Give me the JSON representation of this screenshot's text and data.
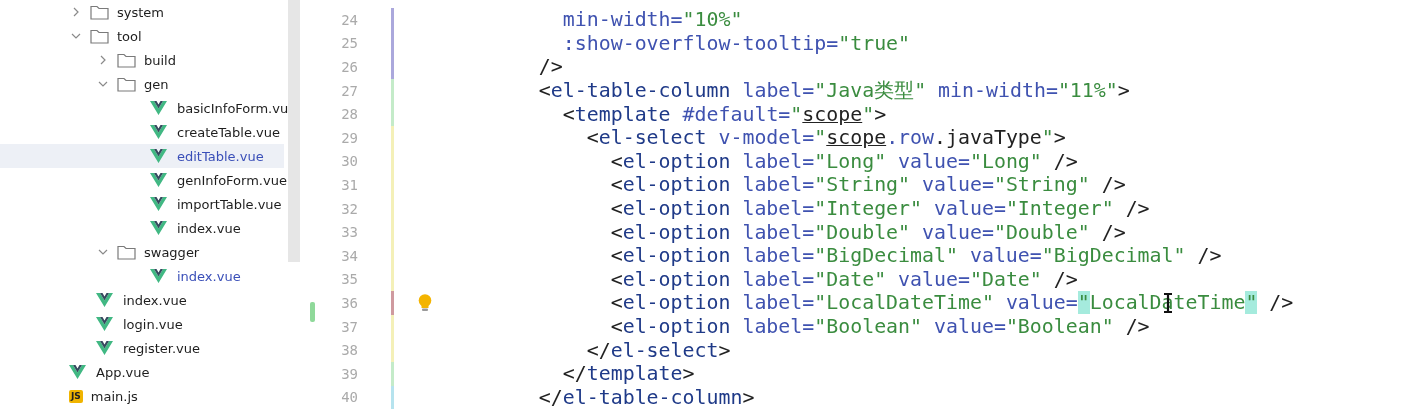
{
  "project_tree": {
    "items": [
      {
        "children": [
          {
            "label": "system",
            "kind": "folder",
            "expanded": false,
            "selected": false,
            "modified": false
          },
          {
            "label": "tool",
            "kind": "folder",
            "expanded": true,
            "selected": false,
            "modified": false,
            "children": [
              {
                "label": "build",
                "kind": "folder",
                "expanded": false,
                "selected": false,
                "modified": false
              },
              {
                "label": "gen",
                "kind": "folder",
                "expanded": true,
                "selected": false,
                "modified": false,
                "children": [
                  {
                    "label": "basicInfoForm.vu",
                    "kind": "vue",
                    "selected": false,
                    "modified": false
                  },
                  {
                    "label": "createTable.vue",
                    "kind": "vue",
                    "selected": false,
                    "modified": false
                  },
                  {
                    "label": "editTable.vue",
                    "kind": "vue",
                    "selected": true,
                    "modified": true
                  },
                  {
                    "label": "genInfoForm.vue",
                    "kind": "vue",
                    "selected": false,
                    "modified": false
                  },
                  {
                    "label": "importTable.vue",
                    "kind": "vue",
                    "selected": false,
                    "modified": false
                  },
                  {
                    "label": "index.vue",
                    "kind": "vue",
                    "selected": false,
                    "modified": false
                  }
                ]
              },
              {
                "label": "swagger",
                "kind": "folder",
                "expanded": true,
                "selected": false,
                "modified": false,
                "children": [
                  {
                    "label": "index.vue",
                    "kind": "vue",
                    "selected": false,
                    "modified": true
                  }
                ]
              }
            ]
          },
          {
            "label": "index.vue",
            "kind": "vue",
            "selected": false,
            "modified": false
          },
          {
            "label": "login.vue",
            "kind": "vue",
            "selected": false,
            "modified": false
          },
          {
            "label": "register.vue",
            "kind": "vue",
            "selected": false,
            "modified": false
          }
        ]
      },
      {
        "label": "App.vue",
        "kind": "vue",
        "selected": false,
        "modified": false
      },
      {
        "label": "main.js",
        "kind": "js",
        "icon_text": "JS",
        "selected": false,
        "modified": false
      }
    ]
  },
  "editor": {
    "lines": [
      {
        "number": "24",
        "color": "#aba8dc",
        "bulb": false,
        "pointer": false,
        "tokens": [
          {
            "kind": "attr",
            "text": "         min-width="
          },
          {
            "kind": "str",
            "text": "\"10%\""
          }
        ]
      },
      {
        "number": "25",
        "color": "#aba8dc",
        "bulb": false,
        "pointer": false,
        "tokens": [
          {
            "kind": "attr",
            "text": "         :show-overflow-tooltip="
          },
          {
            "kind": "str",
            "text": "\"true\""
          }
        ]
      },
      {
        "number": "26",
        "color": "#aba8dc",
        "bulb": false,
        "pointer": false,
        "tokens": [
          {
            "kind": "p",
            "text": "       />"
          }
        ]
      },
      {
        "number": "27",
        "color": "#c4ebc9",
        "bulb": false,
        "pointer": false,
        "tokens": [
          {
            "kind": "p",
            "text": "       <"
          },
          {
            "kind": "tag",
            "text": "el-table-column"
          },
          {
            "kind": "attr",
            "text": " label="
          },
          {
            "kind": "str",
            "text": "\"Java类型\""
          },
          {
            "kind": "attr",
            "text": " min-width="
          },
          {
            "kind": "str",
            "text": "\"11%\""
          },
          {
            "kind": "p",
            "text": ">"
          }
        ]
      },
      {
        "number": "28",
        "color": "#c4ebc9",
        "bulb": false,
        "pointer": false,
        "tokens": [
          {
            "kind": "p",
            "text": "         <"
          },
          {
            "kind": "tag",
            "text": "template"
          },
          {
            "kind": "attr",
            "text": " #default="
          },
          {
            "kind": "str",
            "text": "\""
          },
          {
            "kind": "ref",
            "text": "scope"
          },
          {
            "kind": "str",
            "text": "\""
          },
          {
            "kind": "p",
            "text": ">"
          }
        ]
      },
      {
        "number": "29",
        "color": "#f4f0b8",
        "bulb": false,
        "pointer": false,
        "tokens": [
          {
            "kind": "p",
            "text": "           <"
          },
          {
            "kind": "tag",
            "text": "el-select"
          },
          {
            "kind": "attr",
            "text": " v-model="
          },
          {
            "kind": "str",
            "text": "\""
          },
          {
            "kind": "ref",
            "text": "scope"
          },
          {
            "kind": "prop",
            "text": ".row"
          },
          {
            "kind": "p",
            "text": ".javaType"
          },
          {
            "kind": "str",
            "text": "\""
          },
          {
            "kind": "p",
            "text": ">"
          }
        ]
      },
      {
        "number": "30",
        "color": "#f4f0b8",
        "bulb": false,
        "pointer": false,
        "tokens": [
          {
            "kind": "p",
            "text": "             <"
          },
          {
            "kind": "tag",
            "text": "el-option"
          },
          {
            "kind": "attr",
            "text": " label="
          },
          {
            "kind": "str",
            "text": "\"Long\""
          },
          {
            "kind": "attr",
            "text": " value="
          },
          {
            "kind": "str",
            "text": "\"Long\""
          },
          {
            "kind": "p",
            "text": " />"
          }
        ]
      },
      {
        "number": "31",
        "color": "#f4f0b8",
        "bulb": false,
        "pointer": false,
        "tokens": [
          {
            "kind": "p",
            "text": "             <"
          },
          {
            "kind": "tag",
            "text": "el-option"
          },
          {
            "kind": "attr",
            "text": " label="
          },
          {
            "kind": "str",
            "text": "\"String\""
          },
          {
            "kind": "attr",
            "text": " value="
          },
          {
            "kind": "str",
            "text": "\"String\""
          },
          {
            "kind": "p",
            "text": " />"
          }
        ]
      },
      {
        "number": "32",
        "color": "#f4f0b8",
        "bulb": false,
        "pointer": false,
        "tokens": [
          {
            "kind": "p",
            "text": "             <"
          },
          {
            "kind": "tag",
            "text": "el-option"
          },
          {
            "kind": "attr",
            "text": " label="
          },
          {
            "kind": "str",
            "text": "\"Integer\""
          },
          {
            "kind": "attr",
            "text": " value="
          },
          {
            "kind": "str",
            "text": "\"Integer\""
          },
          {
            "kind": "p",
            "text": " />"
          }
        ]
      },
      {
        "number": "33",
        "color": "#f4f0b8",
        "bulb": false,
        "pointer": false,
        "tokens": [
          {
            "kind": "p",
            "text": "             <"
          },
          {
            "kind": "tag",
            "text": "el-option"
          },
          {
            "kind": "attr",
            "text": " label="
          },
          {
            "kind": "str",
            "text": "\"Double\""
          },
          {
            "kind": "attr",
            "text": " value="
          },
          {
            "kind": "str",
            "text": "\"Double\""
          },
          {
            "kind": "p",
            "text": " />"
          }
        ]
      },
      {
        "number": "34",
        "color": "#f4f0b8",
        "bulb": false,
        "pointer": false,
        "tokens": [
          {
            "kind": "p",
            "text": "             <"
          },
          {
            "kind": "tag",
            "text": "el-option"
          },
          {
            "kind": "attr",
            "text": " label="
          },
          {
            "kind": "str",
            "text": "\"BigDecimal\""
          },
          {
            "kind": "attr",
            "text": " value="
          },
          {
            "kind": "str",
            "text": "\"BigDecimal\""
          },
          {
            "kind": "p",
            "text": " />"
          }
        ]
      },
      {
        "number": "35",
        "color": "#f4f0b8",
        "bulb": false,
        "pointer": false,
        "tokens": [
          {
            "kind": "p",
            "text": "             <"
          },
          {
            "kind": "tag",
            "text": "el-option"
          },
          {
            "kind": "attr",
            "text": " label="
          },
          {
            "kind": "str",
            "text": "\"Date\""
          },
          {
            "kind": "attr",
            "text": " value="
          },
          {
            "kind": "str",
            "text": "\"Date\""
          },
          {
            "kind": "p",
            "text": " />"
          }
        ]
      },
      {
        "number": "36",
        "color": "#cf9a9f",
        "bulb": true,
        "pointer": true,
        "tokens": [
          {
            "kind": "p",
            "text": "             <"
          },
          {
            "kind": "tag",
            "text": "el-option"
          },
          {
            "kind": "attr",
            "text": " label="
          },
          {
            "kind": "str",
            "text": "\"LocalDateTime\""
          },
          {
            "kind": "attr",
            "text": " value="
          },
          {
            "kind": "match",
            "text": "\""
          },
          {
            "kind": "str",
            "text": "LocalDateTime"
          },
          {
            "kind": "match",
            "text": "\""
          },
          {
            "kind": "p",
            "text": " />"
          }
        ]
      },
      {
        "number": "37",
        "color": "#f4f0b8",
        "bulb": false,
        "pointer": false,
        "tokens": [
          {
            "kind": "p",
            "text": "             <"
          },
          {
            "kind": "tag",
            "text": "el-option"
          },
          {
            "kind": "attr",
            "text": " label="
          },
          {
            "kind": "str",
            "text": "\"Boolean\""
          },
          {
            "kind": "attr",
            "text": " value="
          },
          {
            "kind": "str",
            "text": "\"Boolean\""
          },
          {
            "kind": "p",
            "text": " />"
          }
        ]
      },
      {
        "number": "38",
        "color": "#f4f0b8",
        "bulb": false,
        "pointer": false,
        "tokens": [
          {
            "kind": "p",
            "text": "           </"
          },
          {
            "kind": "tag",
            "text": "el-select"
          },
          {
            "kind": "p",
            "text": ">"
          }
        ]
      },
      {
        "number": "39",
        "color": "#c4ebc9",
        "bulb": false,
        "pointer": false,
        "tokens": [
          {
            "kind": "p",
            "text": "         </"
          },
          {
            "kind": "tag",
            "text": "template"
          },
          {
            "kind": "p",
            "text": ">"
          }
        ]
      },
      {
        "number": "40",
        "color": "#b6e3ee",
        "bulb": false,
        "pointer": false,
        "tokens": [
          {
            "kind": "p",
            "text": "       </"
          },
          {
            "kind": "tag",
            "text": "el-table-column"
          },
          {
            "kind": "p",
            "text": ">"
          }
        ]
      }
    ]
  }
}
